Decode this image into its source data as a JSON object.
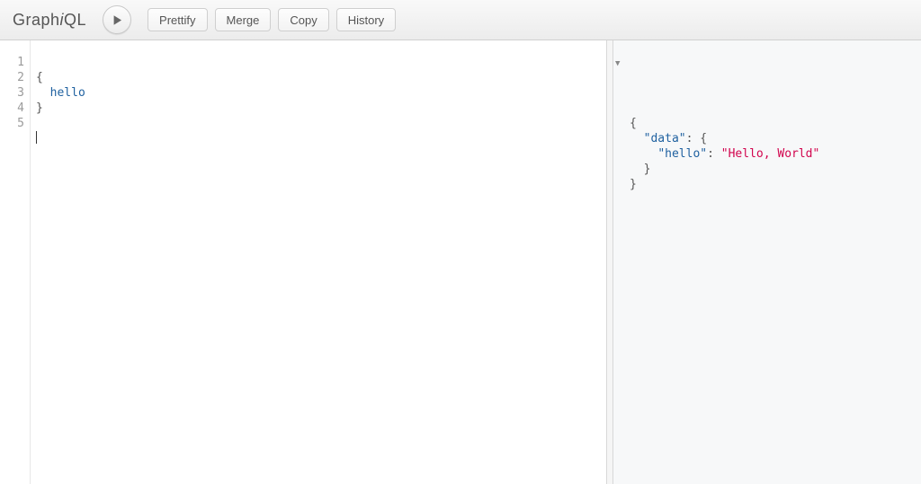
{
  "app": {
    "name_a": "Graph",
    "name_b": "i",
    "name_c": "QL"
  },
  "toolbar": {
    "play_title": "Execute Query",
    "buttons": {
      "prettify": "Prettify",
      "merge": "Merge",
      "copy": "Copy",
      "history": "History"
    }
  },
  "query": {
    "gutter": [
      "1",
      "2",
      "3",
      "4",
      "5"
    ],
    "l1": "{",
    "l2_indent": "  ",
    "l2_field": "hello",
    "l3": "}",
    "l4": "",
    "l5": ""
  },
  "result": {
    "l1": "{",
    "l2a": "  ",
    "l2k": "\"data\"",
    "l2b": ": {",
    "l3a": "    ",
    "l3k": "\"hello\"",
    "l3b": ": ",
    "l3v": "\"Hello, World\"",
    "l4": "  }",
    "l5": "}"
  }
}
